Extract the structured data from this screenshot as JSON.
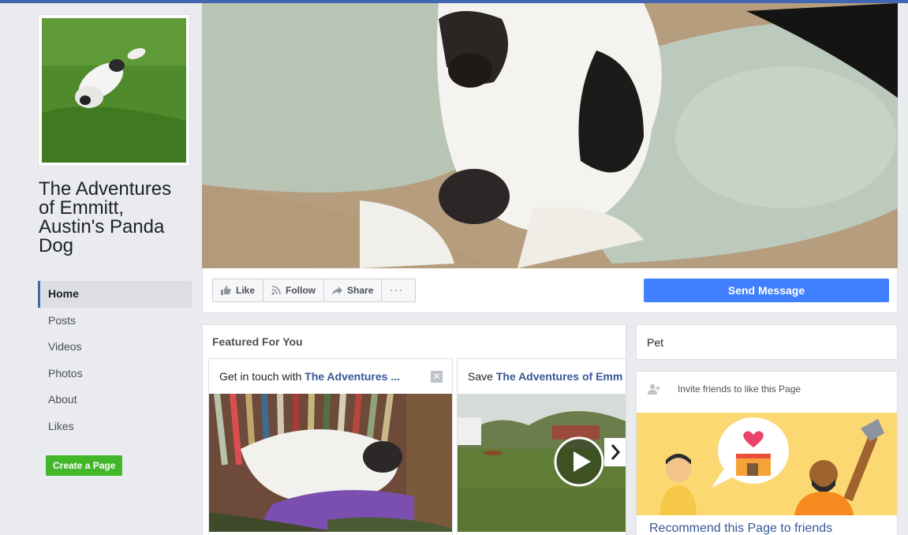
{
  "colors": {
    "brand": "#4267b2",
    "link": "#365899",
    "send_button": "#4080ff",
    "create_button": "#42b72a"
  },
  "page": {
    "title": "The Adventures of Emmitt, Austin's Panda Dog"
  },
  "nav": {
    "items": [
      {
        "label": "Home",
        "active": true
      },
      {
        "label": "Posts"
      },
      {
        "label": "Videos"
      },
      {
        "label": "Photos"
      },
      {
        "label": "About"
      },
      {
        "label": "Likes"
      }
    ],
    "create_page": "Create a Page"
  },
  "actions": {
    "like": "Like",
    "follow": "Follow",
    "share": "Share",
    "more_icon": "ellipsis-icon",
    "send_message": "Send Message"
  },
  "featured": {
    "title": "Featured For You",
    "cards": [
      {
        "prefix": "Get in touch with ",
        "link": "The Adventures ...",
        "close_icon": "close-icon"
      },
      {
        "prefix": "Save ",
        "link": "The Adventures of Emm",
        "play_icon": "play-icon",
        "next_icon": "chevron-right-icon"
      }
    ]
  },
  "category": "Pet",
  "invite": {
    "text": "Invite friends to like this Page",
    "recommend": "Recommend this Page to friends"
  }
}
